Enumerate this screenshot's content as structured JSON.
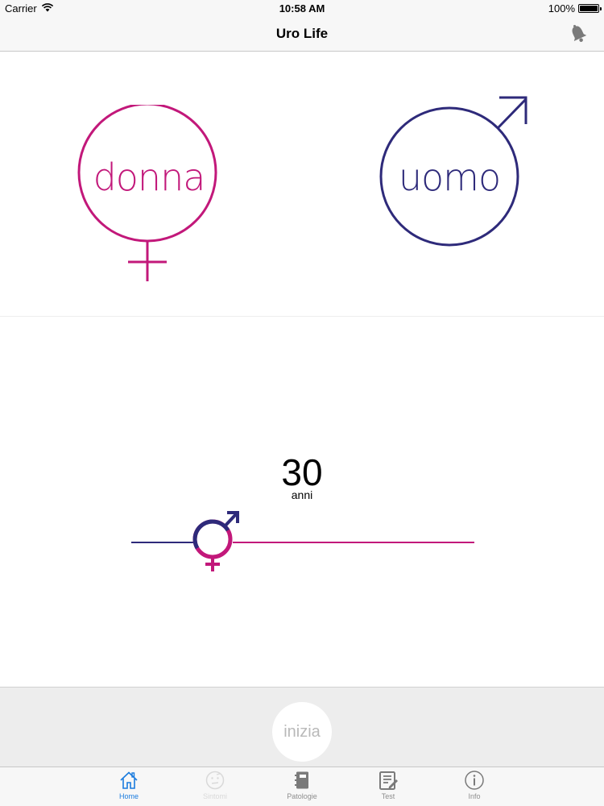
{
  "status_bar": {
    "carrier": "Carrier",
    "time": "10:58 AM",
    "battery": "100%",
    "battery_level": 1.0
  },
  "nav": {
    "title": "Uro Life",
    "bell_icon": "bell-icon"
  },
  "gender": {
    "female_label": "donna",
    "male_label": "uomo",
    "female_color": "#c2187a",
    "male_color": "#2e2a7a"
  },
  "age": {
    "value": "30",
    "unit": "anni",
    "slider_fraction": 0.24
  },
  "start": {
    "label": "inizia"
  },
  "tabs": [
    {
      "label": "Home",
      "icon": "home-icon",
      "state": "active"
    },
    {
      "label": "Sintomi",
      "icon": "thinking-face-icon",
      "state": "disabled"
    },
    {
      "label": "Patologie",
      "icon": "notebook-icon",
      "state": "normal"
    },
    {
      "label": "Test",
      "icon": "checklist-icon",
      "state": "normal"
    },
    {
      "label": "Info",
      "icon": "info-icon",
      "state": "normal"
    }
  ],
  "colors": {
    "accent": "#1a7bde",
    "female": "#c2187a",
    "male": "#2e2a7a"
  }
}
